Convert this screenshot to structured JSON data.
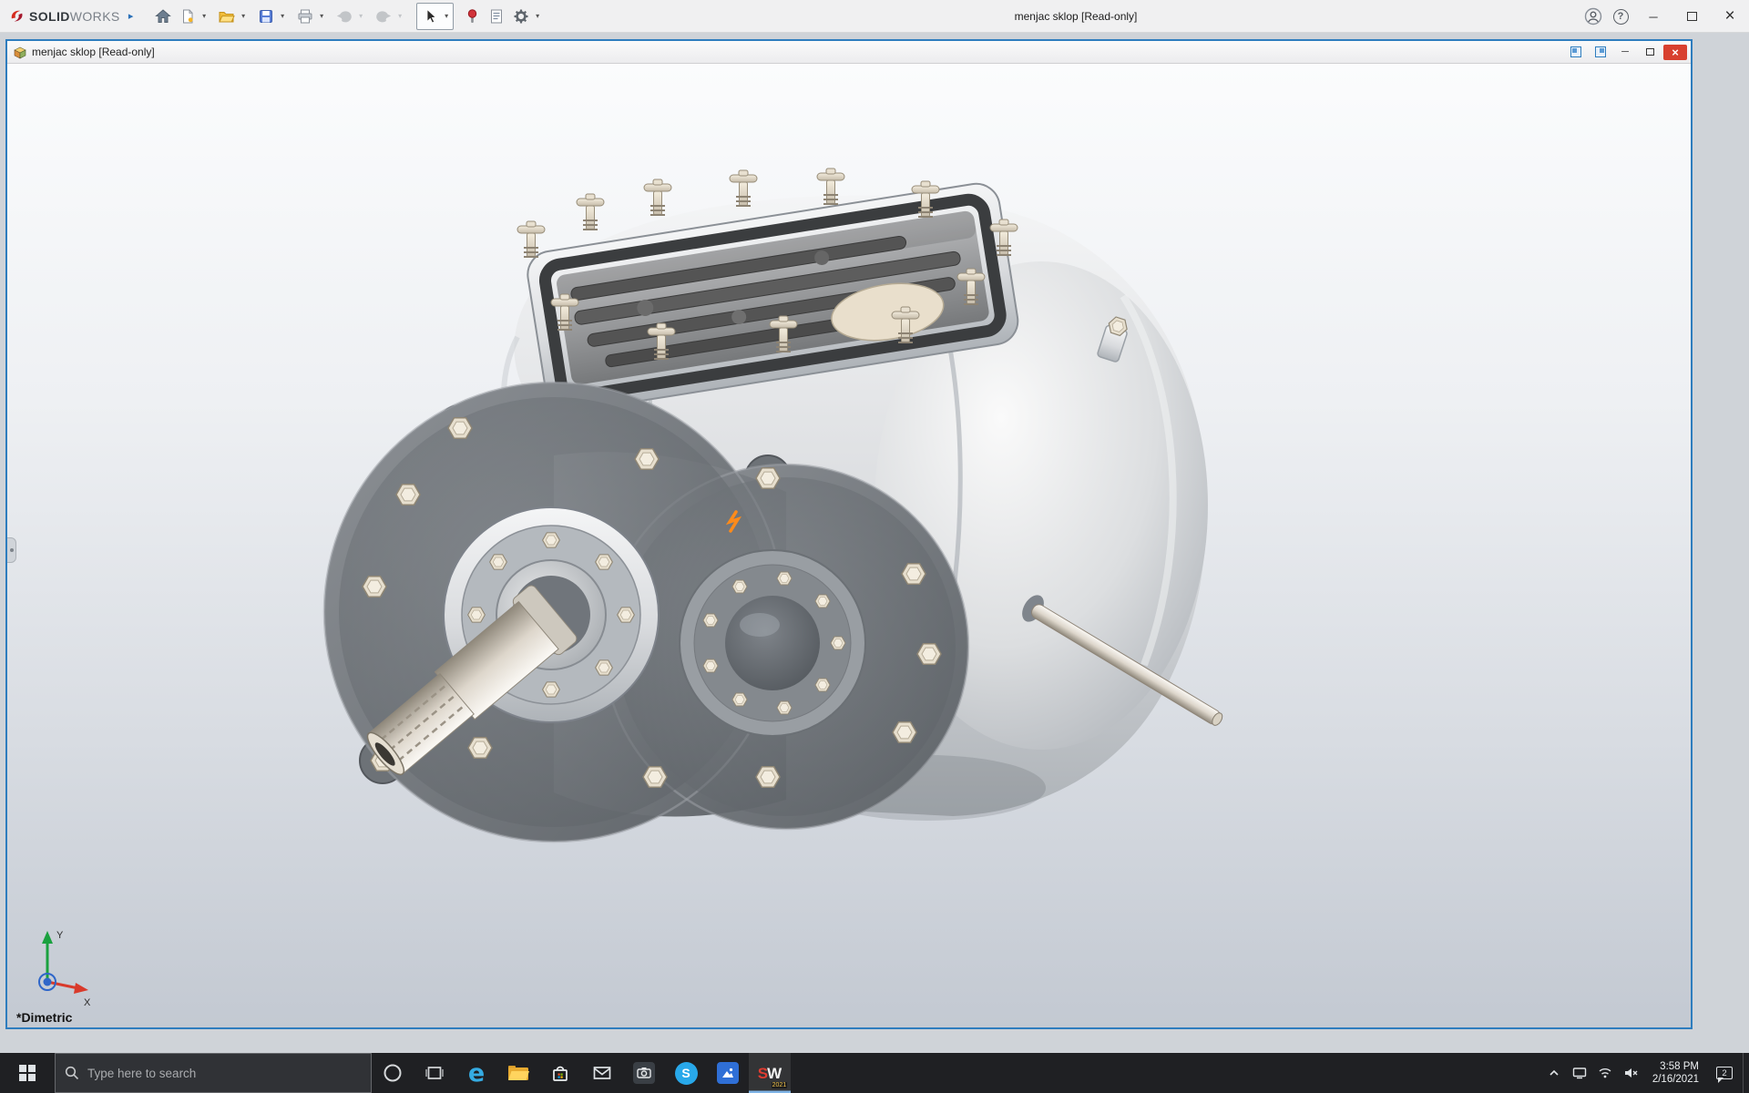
{
  "colors": {
    "accent_blue": "#2e7dbe",
    "titlebar_bg": "#f0f0f1",
    "taskbar_bg": "#1f2023",
    "viewport_top": "#fbfcfd",
    "viewport_bottom": "#c3c9d2",
    "selection_orange": "#ff8b1a"
  },
  "titlebar": {
    "brand_solid": "SOLID",
    "brand_works": "WORKS",
    "title": "menjac sklop [Read-only]"
  },
  "icons": {
    "expand_arrow": "▸",
    "dropdown": "▾",
    "help": "?",
    "minimize": "─",
    "close": "×",
    "edge_letter": "e",
    "skype_letter": "S"
  },
  "document_window": {
    "title": "menjac sklop [Read-only]",
    "view_orientation": "*Dimetric",
    "triad": {
      "x": "X",
      "y": "Y"
    }
  },
  "taskbar": {
    "search_placeholder": "Type here to search",
    "sw_s": "S",
    "sw_w": "W",
    "solidworks_year": "2021",
    "clock_time": "3:58 PM",
    "clock_date": "2/16/2021",
    "notification_badge": "2"
  }
}
